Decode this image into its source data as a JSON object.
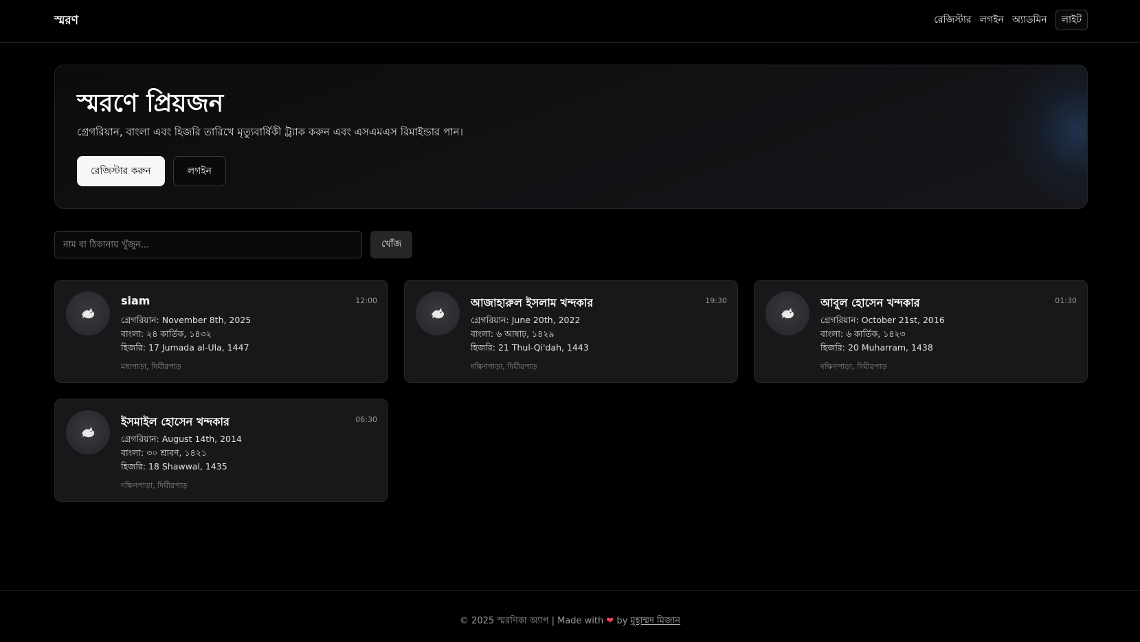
{
  "header": {
    "brand": "স্মরণ",
    "nav": {
      "register": "রেজিস্টার",
      "login": "লগইন",
      "admin": "অ্যাডমিন",
      "theme_toggle": "লাইট"
    }
  },
  "hero": {
    "title": "স্মরণে প্রিয়জন",
    "subtitle": "গ্রেগরিয়ান, বাংলা এবং হিজরি তারিখে মৃত্যুবার্ষিকী ট্র্যাক করুন এবং এসএমএস রিমাইন্ডার পান।",
    "register_button": "রেজিস্টার করুন",
    "login_button": "লগইন"
  },
  "search": {
    "placeholder": "নাম বা ঠিকানায় খুঁজুন...",
    "button": "খোঁজ"
  },
  "cards": [
    {
      "name": "siam",
      "time": "12:00",
      "gregorian": "গ্রেগরিয়ান: November 8th, 2025",
      "bangla": "বাংলা: ২৪ কার্তিক, ১৪৩২",
      "hijri": "হিজরি: 17 Jumada al-Ula, 1447",
      "location": "মধ্যপাড়া, দিঘীরপাড়",
      "icon": "dove-icon"
    },
    {
      "name": "আজাহারুল ইসলাম খন্দকার",
      "time": "19:30",
      "gregorian": "গ্রেগরিয়ান: June 20th, 2022",
      "bangla": "বাংলা: ৬ আষাঢ়, ১৪২৯",
      "hijri": "হিজরি: 21 Thul-Qi'dah, 1443",
      "location": "দক্ষিণপাড়া, দিঘীরপাড়",
      "icon": "dove-icon"
    },
    {
      "name": "আবুল হোসেন খন্দকার",
      "time": "01:30",
      "gregorian": "গ্রেগরিয়ান: October 21st, 2016",
      "bangla": "বাংলা: ৬ কার্তিক, ১৪২৩",
      "hijri": "হিজরি: 20 Muharram, 1438",
      "location": "দক্ষিণপাড়া, দিঘীরপাড়",
      "icon": "dove-icon"
    },
    {
      "name": "ইসমাইল হোসেন খন্দকার",
      "time": "06:30",
      "gregorian": "গ্রেগরিয়ান: August 14th, 2014",
      "bangla": "বাংলা: ৩০ শ্রাবণ, ১৪২১",
      "hijri": "হিজরি: 18 Shawwal, 1435",
      "location": "দক্ষিণপাড়া, দিঘীরপাড়",
      "icon": "dove-icon"
    }
  ],
  "footer": {
    "prefix": "© 2025 স্মরণিকা অ্যাপ | Made with",
    "heart": "❤",
    "by": "by",
    "author": "মুহাম্মদ মিজান"
  },
  "colors": {
    "background": "#000000",
    "card": "#18181b",
    "accent_heart": "#f43f5e"
  }
}
